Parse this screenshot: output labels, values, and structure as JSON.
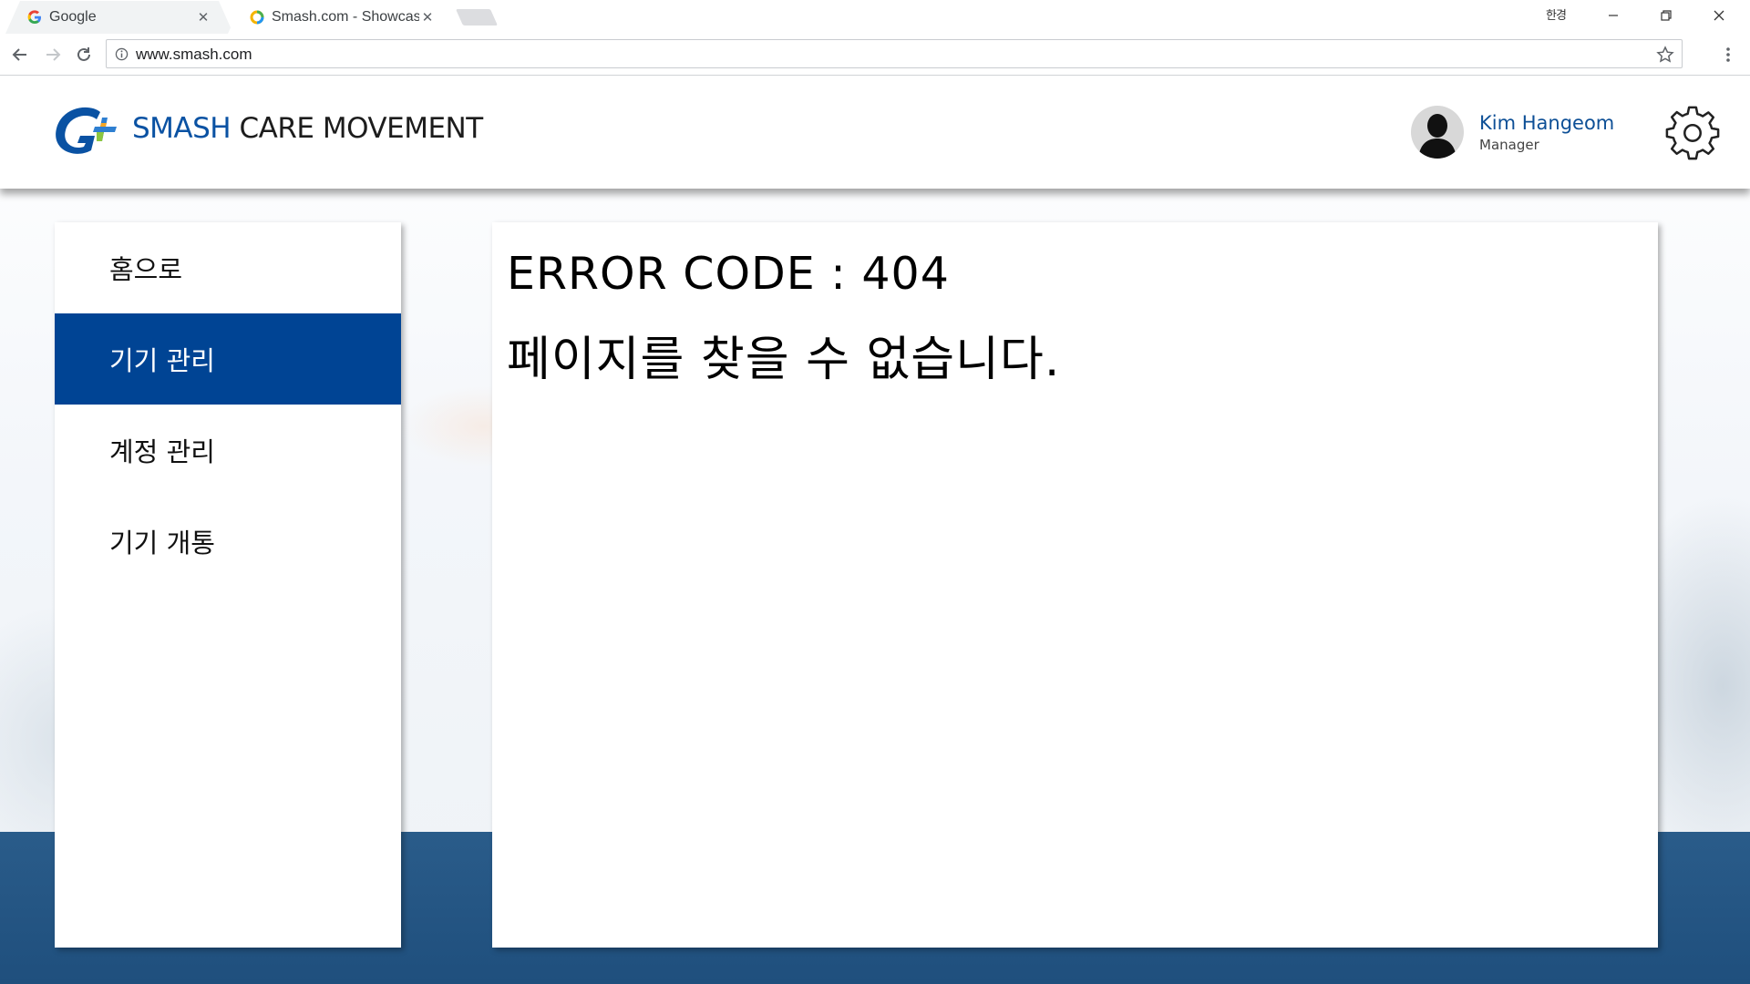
{
  "browser": {
    "tabs": [
      {
        "title": "Google",
        "icon": "google-favicon",
        "active": false
      },
      {
        "title": "Smash.com - Showcasin",
        "icon": "smash-favicon",
        "active": true
      }
    ],
    "window_label": "한경",
    "url": "www.smash.com",
    "icons": [
      "back-icon",
      "forward-icon",
      "reload-icon",
      "info-icon",
      "star-icon",
      "menu-icon",
      "minimize-icon",
      "restore-icon",
      "close-icon"
    ]
  },
  "header": {
    "brand_primary": "SMASH",
    "brand_secondary": "CARE MOVEMENT",
    "user": {
      "name": "Kim Hangeom",
      "role": "Manager"
    },
    "colors": {
      "brand_blue": "#0a52a3",
      "accent": "#004494"
    }
  },
  "sidebar": {
    "items": [
      {
        "label": "홈으로",
        "active": false
      },
      {
        "label": "기기 관리",
        "active": true
      },
      {
        "label": "계정 관리",
        "active": false
      },
      {
        "label": "기기 개통",
        "active": false
      }
    ]
  },
  "main": {
    "error_code": "ERROR CODE : 404",
    "error_message": "페이지를 찾을 수 없습니다."
  }
}
